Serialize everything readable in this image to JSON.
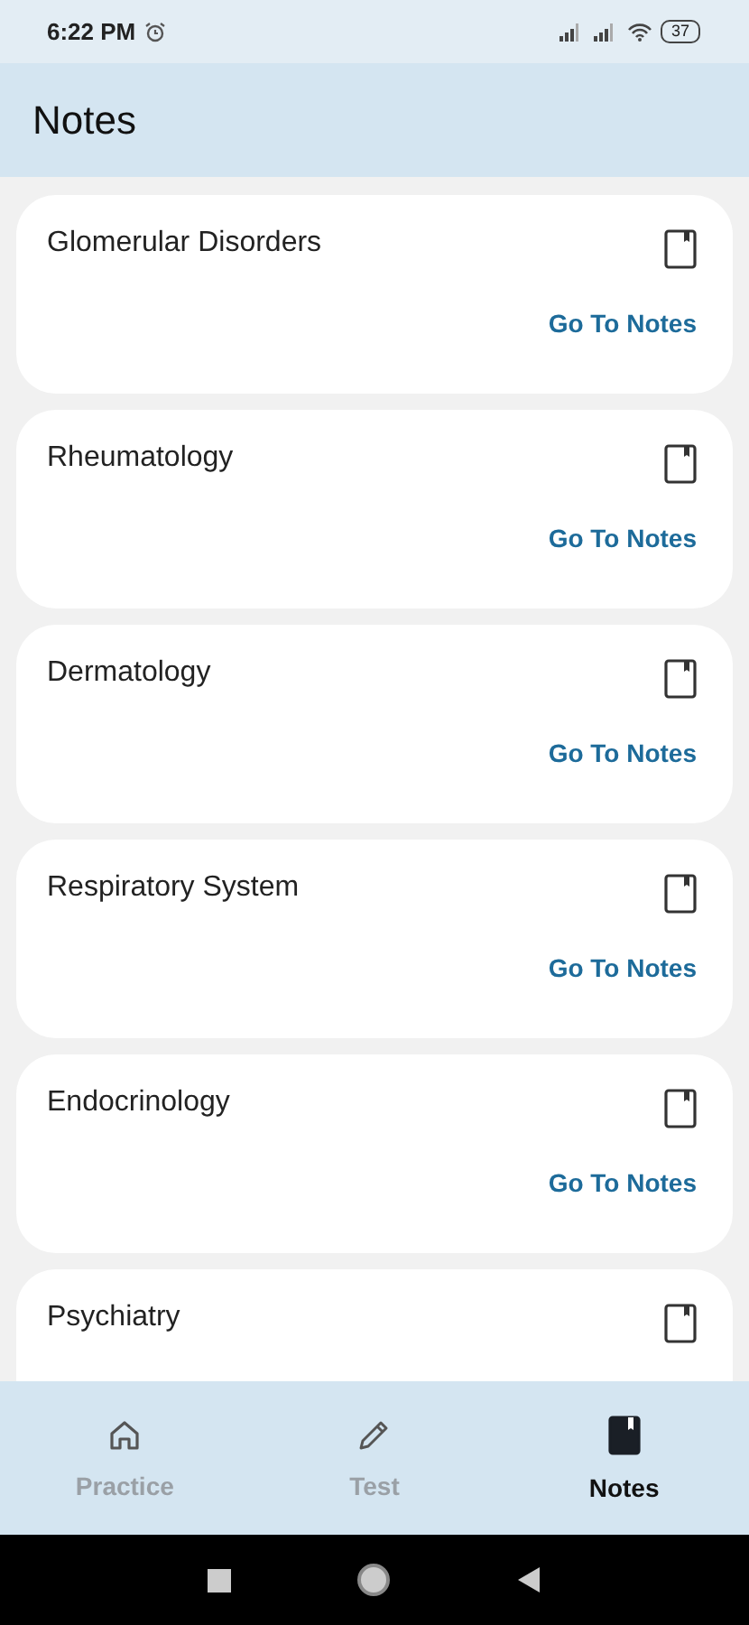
{
  "status_bar": {
    "time": "6:22 PM",
    "battery": "37"
  },
  "app_bar": {
    "title": "Notes"
  },
  "cards": [
    {
      "title": "Glomerular Disorders",
      "link": "Go To Notes"
    },
    {
      "title": "Rheumatology",
      "link": "Go To Notes"
    },
    {
      "title": "Dermatology",
      "link": "Go To Notes"
    },
    {
      "title": "Respiratory System",
      "link": "Go To Notes"
    },
    {
      "title": "Endocrinology",
      "link": "Go To Notes"
    },
    {
      "title": "Psychiatry"
    }
  ],
  "bottom_nav": [
    {
      "label": "Practice",
      "kind": "home",
      "selected": false
    },
    {
      "label": "Test",
      "kind": "pencil",
      "selected": false
    },
    {
      "label": "Notes",
      "kind": "book",
      "selected": true
    }
  ]
}
